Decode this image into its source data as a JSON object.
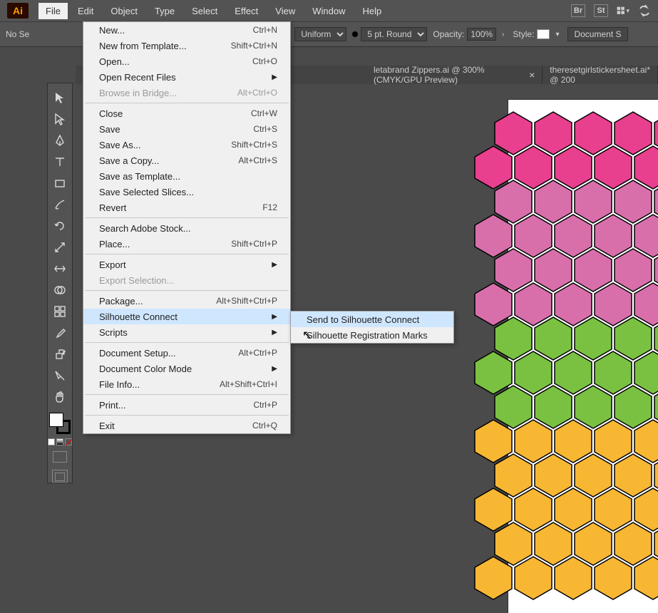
{
  "app_logo": "Ai",
  "menubar": {
    "items": [
      "File",
      "Edit",
      "Object",
      "Type",
      "Select",
      "Effect",
      "View",
      "Window",
      "Help"
    ],
    "active_index": 0,
    "right_boxes": [
      "Br",
      "St"
    ]
  },
  "optionsbar": {
    "no_selection": "No Se",
    "profile_label": "Uniform",
    "stroke_size": "5 pt. Round",
    "opacity_label": "Opacity:",
    "opacity_value": "100%",
    "style_label": "Style:",
    "doc_setup_btn": "Document S"
  },
  "doctabs": {
    "tab1": "letabrand Zippers.ai @ 300% (CMYK/GPU Preview)",
    "tab2": "theresetgirlstickersheet.ai* @ 200"
  },
  "file_menu": [
    {
      "label": "New...",
      "shortcut": "Ctrl+N",
      "type": "item"
    },
    {
      "label": "New from Template...",
      "shortcut": "Shift+Ctrl+N",
      "type": "item"
    },
    {
      "label": "Open...",
      "shortcut": "Ctrl+O",
      "type": "item"
    },
    {
      "label": "Open Recent Files",
      "shortcut": "",
      "type": "sub"
    },
    {
      "label": "Browse in Bridge...",
      "shortcut": "Alt+Ctrl+O",
      "type": "disabled"
    },
    {
      "type": "sep"
    },
    {
      "label": "Close",
      "shortcut": "Ctrl+W",
      "type": "item"
    },
    {
      "label": "Save",
      "shortcut": "Ctrl+S",
      "type": "item"
    },
    {
      "label": "Save As...",
      "shortcut": "Shift+Ctrl+S",
      "type": "item"
    },
    {
      "label": "Save a Copy...",
      "shortcut": "Alt+Ctrl+S",
      "type": "item"
    },
    {
      "label": "Save as Template...",
      "shortcut": "",
      "type": "item"
    },
    {
      "label": "Save Selected Slices...",
      "shortcut": "",
      "type": "item"
    },
    {
      "label": "Revert",
      "shortcut": "F12",
      "type": "item"
    },
    {
      "type": "sep"
    },
    {
      "label": "Search Adobe Stock...",
      "shortcut": "",
      "type": "item"
    },
    {
      "label": "Place...",
      "shortcut": "Shift+Ctrl+P",
      "type": "item"
    },
    {
      "type": "sep"
    },
    {
      "label": "Export",
      "shortcut": "",
      "type": "sub"
    },
    {
      "label": "Export Selection...",
      "shortcut": "",
      "type": "disabled"
    },
    {
      "type": "sep"
    },
    {
      "label": "Package...",
      "shortcut": "Alt+Shift+Ctrl+P",
      "type": "item"
    },
    {
      "label": "Silhouette Connect",
      "shortcut": "",
      "type": "sub",
      "highlight": true
    },
    {
      "label": "Scripts",
      "shortcut": "",
      "type": "sub"
    },
    {
      "type": "sep"
    },
    {
      "label": "Document Setup...",
      "shortcut": "Alt+Ctrl+P",
      "type": "item"
    },
    {
      "label": "Document Color Mode",
      "shortcut": "",
      "type": "sub"
    },
    {
      "label": "File Info...",
      "shortcut": "Alt+Shift+Ctrl+I",
      "type": "item"
    },
    {
      "type": "sep"
    },
    {
      "label": "Print...",
      "shortcut": "Ctrl+P",
      "type": "item"
    },
    {
      "type": "sep"
    },
    {
      "label": "Exit",
      "shortcut": "Ctrl+Q",
      "type": "item"
    }
  ],
  "submenu": {
    "items": [
      "Send to Silhouette Connect",
      "Silhouette Registration Marks"
    ],
    "highlight_index": 0
  },
  "hex_colors": {
    "rows": [
      {
        "color": "#e83f8e",
        "count_offset": 0
      },
      {
        "color": "#e83f8e",
        "count_offset": 1
      },
      {
        "color": "#d86fab",
        "count_offset": 0
      },
      {
        "color": "#d86fab",
        "count_offset": 1
      },
      {
        "color": "#d86fab",
        "count_offset": 0
      },
      {
        "color": "#d86fab",
        "count_offset": 1
      },
      {
        "color": "#7ac142",
        "count_offset": 0
      },
      {
        "color": "#7ac142",
        "count_offset": 1
      },
      {
        "color": "#7ac142",
        "count_offset": 0
      },
      {
        "color": "#f7b733",
        "count_offset": 1
      },
      {
        "color": "#f7b733",
        "count_offset": 0
      },
      {
        "color": "#f7b733",
        "count_offset": 1
      },
      {
        "color": "#f7b733",
        "count_offset": 0
      },
      {
        "color": "#f7b733",
        "count_offset": 1
      }
    ]
  }
}
